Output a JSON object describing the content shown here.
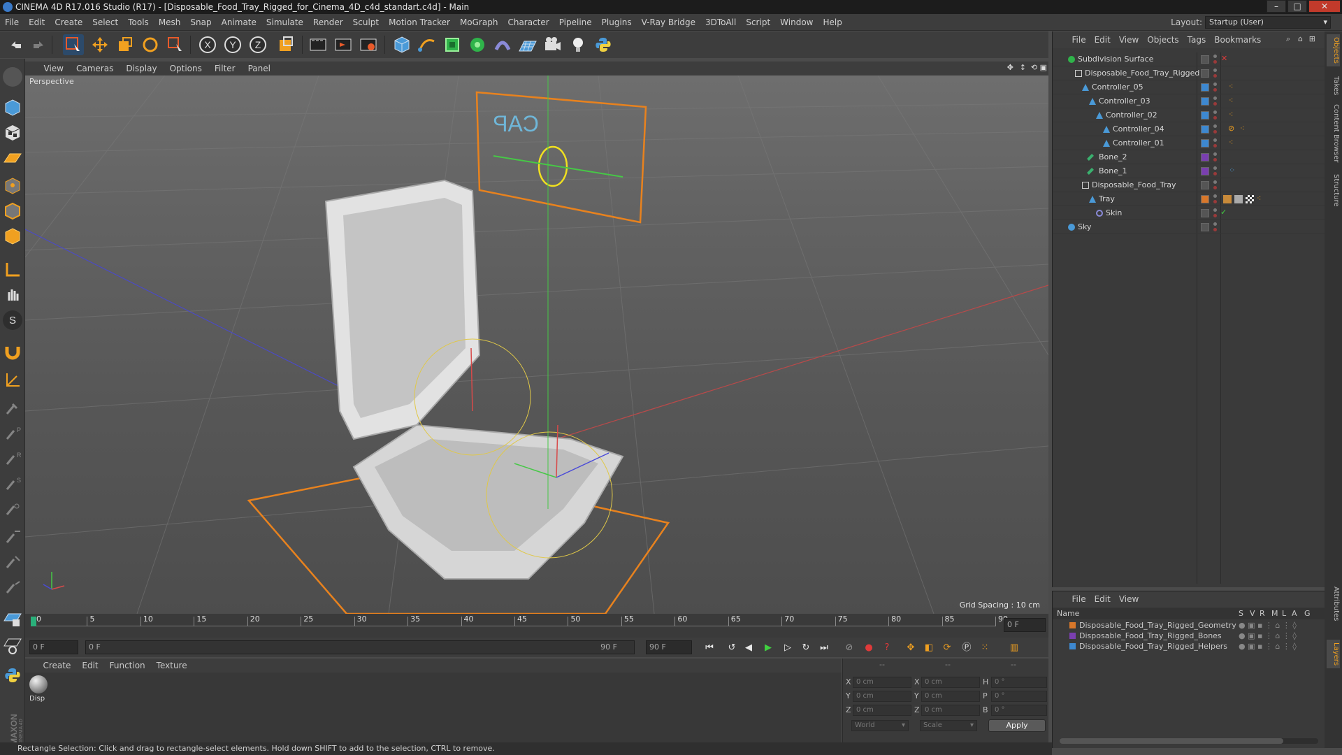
{
  "window": {
    "title": "CINEMA 4D R17.016 Studio (R17) - [Disposable_Food_Tray_Rigged_for_Cinema_4D_c4d_standart.c4d] - Main"
  },
  "menubar": {
    "items": [
      "File",
      "Edit",
      "Create",
      "Select",
      "Tools",
      "Mesh",
      "Snap",
      "Animate",
      "Simulate",
      "Render",
      "Sculpt",
      "Motion Tracker",
      "MoGraph",
      "Character",
      "Pipeline",
      "Plugins",
      "V-Ray Bridge",
      "3DToAll",
      "Script",
      "Window",
      "Help"
    ],
    "layout_label": "Layout:",
    "layout_value": "Startup (User)"
  },
  "viewport": {
    "menu": [
      "View",
      "Cameras",
      "Display",
      "Options",
      "Filter",
      "Panel"
    ],
    "label": "Perspective",
    "grid_spacing": "Grid Spacing : 10 cm",
    "gizmo_text": "CAP"
  },
  "timeline": {
    "ticks": [
      "0",
      "5",
      "10",
      "15",
      "20",
      "25",
      "30",
      "35",
      "40",
      "45",
      "50",
      "55",
      "60",
      "65",
      "70",
      "75",
      "80",
      "85",
      "90"
    ],
    "current_frame": "0 F",
    "start_field": "0 F",
    "range_start": "0 F",
    "range_end": "90 F",
    "end_field": "90 F"
  },
  "material_editor": {
    "menu": [
      "Create",
      "Edit",
      "Function",
      "Texture"
    ],
    "material_label": "Disp"
  },
  "coordinates": {
    "header": [
      "--",
      "--",
      "--"
    ],
    "rows": [
      {
        "a": "X",
        "av": "0 cm",
        "b": "X",
        "bv": "0 cm",
        "c": "H",
        "cv": "0 °"
      },
      {
        "a": "Y",
        "av": "0 cm",
        "b": "Y",
        "bv": "0 cm",
        "c": "P",
        "cv": "0 °"
      },
      {
        "a": "Z",
        "av": "0 cm",
        "b": "Z",
        "bv": "0 cm",
        "c": "B",
        "cv": "0 °"
      }
    ],
    "mode": "World",
    "scale": "Scale",
    "apply": "Apply"
  },
  "statusbar": {
    "text": "Rectangle Selection: Click and drag to rectangle-select elements. Hold down SHIFT to add to the selection, CTRL to remove."
  },
  "objects": {
    "menu": [
      "File",
      "Edit",
      "View",
      "Objects",
      "Tags",
      "Bookmarks"
    ],
    "items": [
      {
        "name": "Subdivision Surface",
        "color": "#2fb34a"
      },
      {
        "name": "Disposable_Food_Tray_Rigged",
        "color": "#d0d0d0"
      },
      {
        "name": "Controller_05",
        "color": "#4a9ad8"
      },
      {
        "name": "Controller_03",
        "color": "#4a9ad8"
      },
      {
        "name": "Controller_02",
        "color": "#4a9ad8"
      },
      {
        "name": "Controller_04",
        "color": "#4a9ad8"
      },
      {
        "name": "Controller_01",
        "color": "#4a9ad8"
      },
      {
        "name": "Bone_2",
        "color": "#3ab06e"
      },
      {
        "name": "Bone_1",
        "color": "#3ab06e"
      },
      {
        "name": "Disposable_Food_Tray",
        "color": "#d0d0d0"
      },
      {
        "name": "Tray",
        "color": "#4a9ad8"
      },
      {
        "name": "Skin",
        "color": "#8a8ad8"
      },
      {
        "name": "Sky",
        "color": "#4a9ad8"
      }
    ]
  },
  "layers": {
    "menu": [
      "File",
      "Edit",
      "View"
    ],
    "header": {
      "name": "Name",
      "cols": [
        "S",
        "V",
        "R",
        "M",
        "L",
        "A",
        "G"
      ]
    },
    "items": [
      {
        "name": "Disposable_Food_Tray_Rigged_Geometry",
        "color": "#d8772a"
      },
      {
        "name": "Disposable_Food_Tray_Rigged_Bones",
        "color": "#7a3fb0"
      },
      {
        "name": "Disposable_Food_Tray_Rigged_Helpers",
        "color": "#3d88d0"
      }
    ]
  },
  "right_tabs": [
    "Objects",
    "Takes",
    "Content Browser",
    "Structure",
    "Attributes",
    "Layers"
  ],
  "brand": "MAXON CINEMA 4D"
}
